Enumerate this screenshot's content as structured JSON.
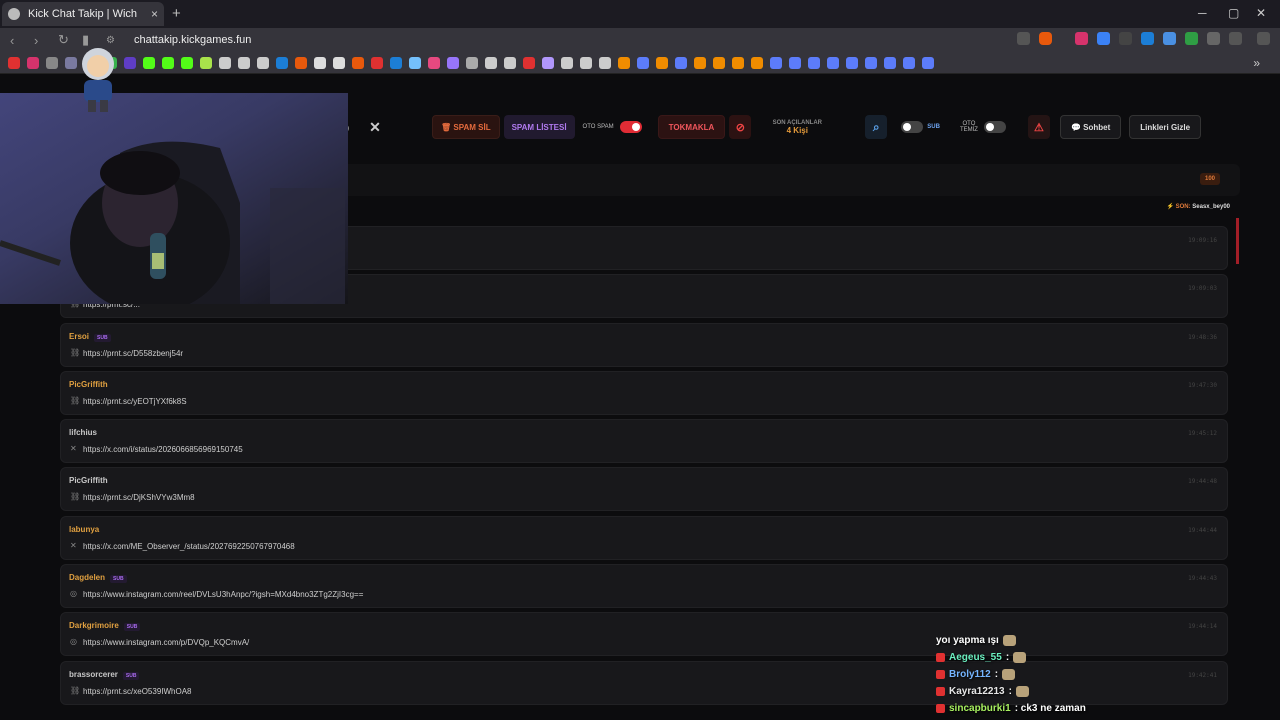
{
  "browser": {
    "tab_title": "Kick Chat Takip | Wich",
    "close_glyph": "×",
    "new_tab_glyph": "+",
    "url": "chattakip.kickgames.fun",
    "bookmark_colors": [
      "#e03131",
      "#d6336c",
      "#888",
      "#7a7aa0",
      "#e64980",
      "#37b24d",
      "#5f3dc4",
      "#53fc18",
      "#53fc18",
      "#53fc18",
      "#a9e34b",
      "#ccc",
      "#ccc",
      "#ccc",
      "#1c7ed6",
      "#e8590c",
      "#ddd",
      "#ddd",
      "#e8590c",
      "#e03131",
      "#1c7ed6",
      "#74c0fc",
      "#e64980",
      "#9775fa",
      "#aaa",
      "#ccc",
      "#ccc",
      "#e03131",
      "#b197fc",
      "#ccc",
      "#ccc",
      "#ccc",
      "#f08c00",
      "#5c7cfa",
      "#f08c00",
      "#5c7cfa",
      "#f08c00",
      "#f08c00",
      "#f08c00",
      "#f08c00",
      "#5c7cfa",
      "#5c7cfa",
      "#5c7cfa",
      "#5c7cfa",
      "#5c7cfa",
      "#5c7cfa",
      "#5c7cfa",
      "#5c7cfa",
      "#5c7cfa"
    ]
  },
  "toolbar": {
    "spam_sil": "SPAM SİL",
    "spam_listesi": "SPAM LİSTESİ",
    "oto_spam": "OTO SPAM",
    "tokmakla": "TOKMAKLA",
    "son_acilanlar_label": "SON AÇILANLAR",
    "son_acilanlar_value": "4 Kişi",
    "sub_label": "SUB",
    "oto_temiz": "OTO TEMİZ",
    "sohbet": "Sohbet",
    "linkleri_gizle": "Linkleri Gizle"
  },
  "panel": {
    "count": "100",
    "son_label": "SON:",
    "son_user": "Seasx_bey00"
  },
  "rows": [
    {
      "user": "",
      "sub": false,
      "icon": "",
      "link": "",
      "time": "19:09:16",
      "color": "#d4a03a"
    },
    {
      "user": "",
      "sub": false,
      "icon": "link",
      "link": "https://prnt.sc/...",
      "time": "19:09:03",
      "color": "#d4a03a"
    },
    {
      "user": "Ersoi",
      "sub": true,
      "icon": "link",
      "link": "https://prnt.sc/D558zbenj54r",
      "time": "19:48:36",
      "color": "#e0a040"
    },
    {
      "user": "PicGriffith",
      "sub": false,
      "icon": "link",
      "link": "https://prnt.sc/yEOTjYXf6k8S",
      "time": "19:47:30",
      "color": "#e0a040"
    },
    {
      "user": "lifchius",
      "sub": false,
      "icon": "x",
      "link": "https://x.com/i/status/2026066856969150745",
      "time": "19:45:12",
      "color": "#c8c8c8"
    },
    {
      "user": "PicGriffith",
      "sub": false,
      "icon": "link",
      "link": "https://prnt.sc/DjKShVYw3Mm8",
      "time": "19:44:48",
      "color": "#c8c8c8"
    },
    {
      "user": "labunya",
      "sub": false,
      "icon": "x",
      "link": "https://x.com/ME_Observer_/status/2027692250767970468",
      "time": "19:44:44",
      "color": "#e0a040"
    },
    {
      "user": "Dagdelen",
      "sub": true,
      "icon": "instagram",
      "link": "https://www.instagram.com/reel/DVLsU3hAnpc/?igsh=MXd4bno3ZTg2ZjI3cg==",
      "time": "19:44:43",
      "color": "#e0a040"
    },
    {
      "user": "Darkgrimoire",
      "sub": true,
      "icon": "instagram",
      "link": "https://www.instagram.com/p/DVQp_KQCmvA/",
      "time": "19:44:14",
      "color": "#e0a040"
    },
    {
      "user": "brassorcerer",
      "sub": true,
      "icon": "link",
      "link": "https://prnt.sc/xeO539IWhOA8",
      "time": "19:42:41",
      "color": "#c8c8c8"
    }
  ],
  "chat_overlay": [
    {
      "user": "",
      "text": "yoı yapma ışı",
      "color": "#ffffff",
      "emote": true
    },
    {
      "user": "Aegeus_55",
      "text": " :",
      "color": "#6bf0c0",
      "emote": true
    },
    {
      "user": "Broly112",
      "text": " :",
      "color": "#74b4ff",
      "emote": true
    },
    {
      "user": "Kayra12213",
      "text": " :",
      "color": "#e6e6e6",
      "emote": true
    },
    {
      "user": "sincapburki1",
      "text": " : ck3 ne zaman",
      "color": "#a8f060",
      "emote": false
    }
  ]
}
